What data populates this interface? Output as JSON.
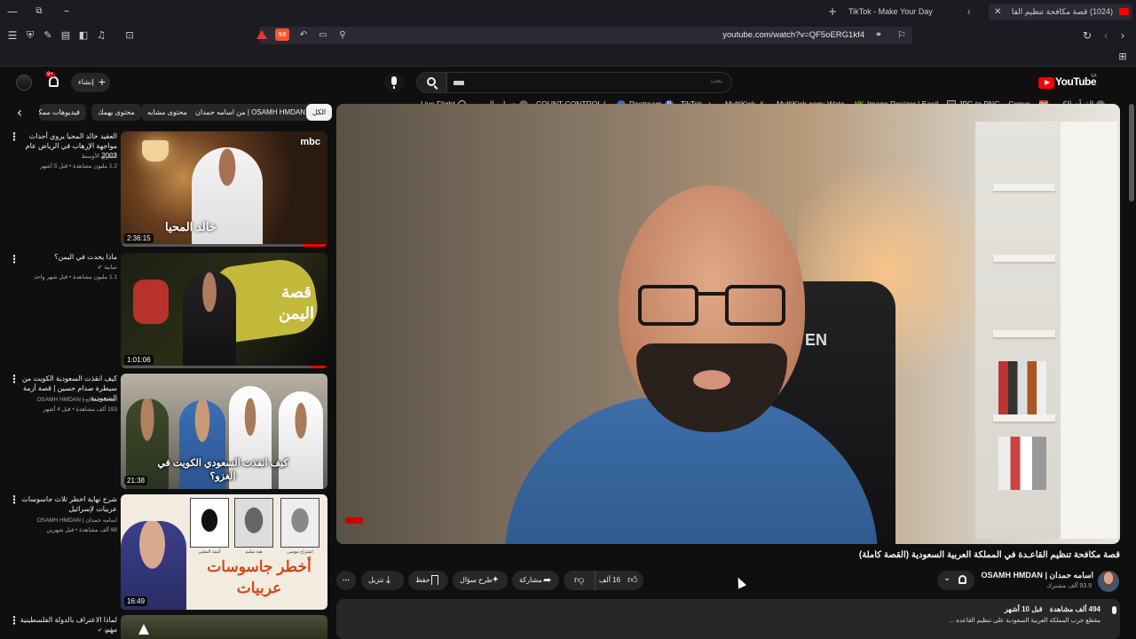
{
  "browser": {
    "tabs": [
      {
        "label": "(1024) قصة مكافحة تنظيم القا"
      },
      {
        "label": "TikTok - Make Your Day"
      }
    ],
    "url": "youtube.com/watch?v=QF5oERG1kf4",
    "shield_count": "98",
    "bookmarks": [
      {
        "label": "Live Flight"
      },
      {
        "label": "حساب العمر"
      },
      {
        "label": "COUNT CONTROL L..."
      },
      {
        "label": "Restream"
      },
      {
        "label": "TikTok"
      },
      {
        "label": "MultiKick"
      },
      {
        "label": "MultiKick.com: Watc..."
      },
      {
        "label": "Image Resizer | Easil..."
      },
      {
        "label": "JPG to PNG – Conve..."
      },
      {
        "label": "القرآن الكريم"
      }
    ]
  },
  "masthead": {
    "logo": "YouTube",
    "logo_region": "SA",
    "search_placeholder": "بحث",
    "create_label": "إنشاء",
    "notif_count": "9+"
  },
  "chips": [
    {
      "label": "الكل"
    },
    {
      "label": "من اسامه حمدان | OSAMH HMDAN"
    },
    {
      "label": "محتوى مشابه"
    },
    {
      "label": "محتوى يهمك"
    },
    {
      "label": "فيديوهات ممكنة..."
    }
  ],
  "recommendations": [
    {
      "title": "العقيد خالد المحيا يروي أحداث مواجهة الإرهاب في الرياض عام 2003",
      "channel": "الشرق الأوسط",
      "meta": "1.2 مليون مشاهدة • قبل 5 أشهر",
      "duration": "2:36:15",
      "thumb_text": "خالد المحيا",
      "thumb_badge": "mbc"
    },
    {
      "title": "ماذا يحدث في اليمن؟",
      "channel": "ثمانية",
      "meta": "1.1 مليون مشاهدة • قبل شهر واحد",
      "duration": "1:01:06",
      "thumb_text": "قصة اليمن"
    },
    {
      "title": "كيف انقذت السعودية الكويت من سيطرة صدام حسين | قصة أزمة السعودية ...",
      "channel": "اسامه حمدان | OSAMH HMDAN",
      "meta": "193 ألف مشاهدة • قبل 4 أشهر",
      "duration": "21:38",
      "thumb_text": "كيف انقذت السعودي الكويت في الغزو؟"
    },
    {
      "title": "شرح نهاية اخطر ثلاث جاسوسات عربيات لإسرائيل",
      "channel": "اسامه حمدان | OSAMH HMDAN",
      "meta": "98 ألف مشاهدة • قبل شهرين",
      "duration": "16:49",
      "thumb_text": "أخطر جاسوسات عربيات",
      "portrait_names": [
        "أمينة المفتي",
        "هبة سليم",
        "انشراح موسى"
      ]
    },
    {
      "title": "لماذا الاعتراف بالدولة الفلسطينية مهم",
      "channel": "ثمانية",
      "meta": "",
      "duration": ""
    }
  ],
  "player": {
    "title": "قصة مكافحة تنظيم القاعـدة في المملكة العربية السعودية (القصة كاملة)",
    "channel": "اسامه حمدان | OSAMH HMDAN",
    "subscribers": "93.9 ألف مشترك",
    "likes": "16 ألف",
    "share_label": "مشاركة",
    "ask_label": "طرح سؤال",
    "save_label": "حفظ",
    "download_label": "تنزيل",
    "views": "494 ألف مشاهدة",
    "age": "قبل 10 أشهر",
    "desc": "مقطع حرب المملكة العربية السعودية على تنظيم القاعده ...",
    "wall_text": "EN"
  },
  "colors": {
    "accent": "#ff0000",
    "bg": "#0f0f0f"
  }
}
